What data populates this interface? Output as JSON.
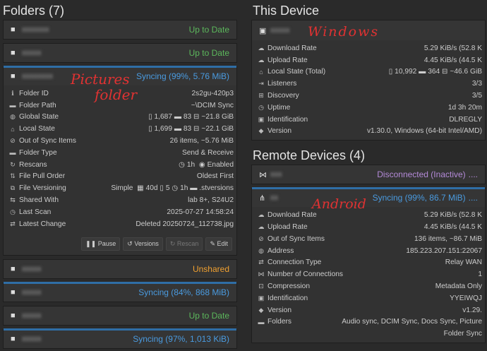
{
  "left": {
    "title": "Folders (7)",
    "folders": [
      {
        "status": "Up to Date"
      },
      {
        "status": "Up to Date"
      },
      {
        "status": "Syncing (99%, 5.76 MiB)"
      }
    ],
    "expanded": {
      "folder_id_label": "Folder ID",
      "folder_id": "2s2gu-420p3",
      "folder_path_label": "Folder Path",
      "folder_path": "~\\DCIM Sync",
      "global_state_label": "Global State",
      "global_files": "1,687",
      "global_dirs": "83",
      "global_size": "~21.8 GiB",
      "local_state_label": "Local State",
      "local_files": "1,699",
      "local_dirs": "83",
      "local_size": "~22.1 GiB",
      "out_of_sync_label": "Out of Sync Items",
      "out_of_sync": "26 items, ~5.76 MiB",
      "folder_type_label": "Folder Type",
      "folder_type": "Send & Receive",
      "rescans_label": "Rescans",
      "rescans_interval": "1h",
      "rescans_watch": "Enabled",
      "pull_order_label": "File Pull Order",
      "pull_order": "Oldest First",
      "versioning_label": "File Versioning",
      "versioning_type": "Simple",
      "versioning_days": "40d",
      "versioning_keep": "5",
      "versioning_interval": "1h",
      "versioning_path": ".stversions",
      "shared_label": "Shared With",
      "shared_with": "lab 8+, S24U2",
      "last_scan_label": "Last Scan",
      "last_scan": "2025-07-27 14:58:24",
      "latest_change_label": "Latest Change",
      "latest_change": "Deleted 20250724_112738.jpg",
      "pause": "Pause",
      "versions": "Versions",
      "rescan": "Rescan",
      "edit": "Edit"
    },
    "folders_after": [
      {
        "status": "Unshared"
      },
      {
        "status": "Syncing (84%, 868 MiB)"
      },
      {
        "status": "Up to Date"
      },
      {
        "status": "Syncing (97%, 1,013 KiB)"
      }
    ],
    "annotation_line1": "Pictures",
    "annotation_line2": "folder"
  },
  "right": {
    "title": "This Device",
    "annotation_device": "Windows",
    "this_device": {
      "download_label": "Download Rate",
      "download": "5.29 KiB/s (52.8 K",
      "upload_label": "Upload Rate",
      "upload": "4.45 KiB/s (44.5 K",
      "local_label": "Local State (Total)",
      "local_files": "10,992",
      "local_dirs": "364",
      "local_size": "~46.6 GiB",
      "listeners_label": "Listeners",
      "listeners": "3/3",
      "discovery_label": "Discovery",
      "discovery": "3/5",
      "uptime_label": "Uptime",
      "uptime": "1d 3h 20m",
      "ident_label": "Identification",
      "ident": "DLREGLY",
      "version_label": "Version",
      "version": "v1.30.0, Windows (64-bit Intel/AMD)"
    },
    "remote_title": "Remote Devices (4)",
    "remote1_status": "Disconnected (Inactive)",
    "remote2_status": "Syncing (99%, 86.7 MiB)",
    "annotation_android": "Android",
    "remote": {
      "download_label": "Download Rate",
      "download": "5.29 KiB/s (52.8 K",
      "upload_label": "Upload Rate",
      "upload": "4.45 KiB/s (44.5 K",
      "oos_label": "Out of Sync Items",
      "oos": "136 items, ~86.7 MiB",
      "address_label": "Address",
      "address": "185.223.207.151:22067",
      "conn_label": "Connection Type",
      "conn": "Relay WAN",
      "numconn_label": "Number of Connections",
      "numconn": "1",
      "compress_label": "Compression",
      "compress": "Metadata Only",
      "ident_label": "Identification",
      "ident": "YYEIWQJ",
      "version_label": "Version",
      "version": "v1.29.",
      "folders_label": "Folders",
      "folders": "Audio sync, DCIM Sync, Docs Sync, Picture",
      "folders2": "Folder Sync"
    }
  },
  "colors": {
    "green": "#5cb85c",
    "blue": "#4a9be0",
    "orange": "#f0a030",
    "purple": "#b48ad8",
    "annotation": "#e03232"
  }
}
